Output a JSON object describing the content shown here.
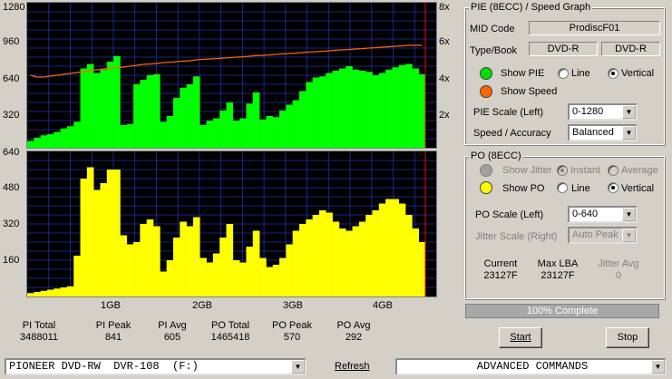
{
  "pie_graph": {
    "left_ticks": [
      "1280",
      "960",
      "640",
      "320"
    ],
    "right_ticks": [
      "8x",
      "6x",
      "4x",
      "2x"
    ]
  },
  "po_graph": {
    "left_ticks": [
      "640",
      "480",
      "320",
      "160"
    ]
  },
  "x_ticks": [
    "1GB",
    "2GB",
    "3GB",
    "4GB"
  ],
  "chart_data": [
    {
      "type": "area",
      "name": "PIE (8ECC)",
      "ylim": [
        0,
        1280
      ],
      "y2lim": [
        0,
        8
      ],
      "yticks": [
        320,
        640,
        960,
        1280
      ],
      "y2ticks": [
        "2x",
        "4x",
        "6x",
        "8x"
      ],
      "xticks": [
        "1GB",
        "2GB",
        "3GB",
        "4GB"
      ],
      "series": [
        {
          "color": "#00ff00",
          "values": [
            60,
            90,
            110,
            120,
            140,
            170,
            190,
            230,
            700,
            740,
            660,
            690,
            760,
            810,
            200,
            210,
            560,
            600,
            640,
            650,
            230,
            280,
            440,
            530,
            560,
            630,
            200,
            240,
            260,
            330,
            400,
            240,
            260,
            390,
            490,
            250,
            280,
            270,
            330,
            380,
            420,
            500,
            580,
            620,
            630,
            660,
            680,
            700,
            720,
            690,
            680,
            670,
            640,
            660,
            690,
            710,
            730,
            740,
            700,
            650
          ]
        },
        {
          "color": "#ff6600",
          "values": [
            4.0,
            3.9,
            3.9,
            3.95,
            4.0,
            4.05,
            4.1,
            4.15,
            4.2,
            4.25,
            4.3,
            4.35,
            4.4,
            4.42,
            4.45,
            4.5,
            4.55,
            4.6,
            4.62,
            4.65,
            4.7,
            4.72,
            4.75,
            4.78,
            4.8,
            4.85,
            4.88,
            4.9,
            4.92,
            4.95,
            4.97,
            5.0,
            5.02,
            5.05,
            5.08,
            5.1,
            5.12,
            5.15,
            5.18,
            5.2,
            5.22,
            5.25,
            5.28,
            5.3,
            5.32,
            5.35,
            5.38,
            5.4,
            5.42,
            5.45,
            5.47,
            5.5,
            5.52,
            5.55,
            5.57,
            5.6,
            5.62,
            5.65,
            5.65,
            5.65
          ]
        }
      ]
    },
    {
      "type": "area",
      "name": "PO (8ECC)",
      "ylim": [
        0,
        640
      ],
      "yticks": [
        160,
        320,
        480,
        640
      ],
      "xticks": [
        "1GB",
        "2GB",
        "3GB",
        "4GB"
      ],
      "series": [
        {
          "color": "#ffff00",
          "values": [
            15,
            20,
            25,
            30,
            35,
            40,
            45,
            180,
            520,
            570,
            470,
            500,
            560,
            560,
            270,
            230,
            240,
            320,
            340,
            310,
            110,
            160,
            260,
            330,
            310,
            350,
            170,
            150,
            190,
            260,
            320,
            160,
            150,
            220,
            290,
            170,
            130,
            140,
            170,
            230,
            290,
            320,
            340,
            360,
            380,
            370,
            330,
            300,
            290,
            310,
            330,
            360,
            380,
            410,
            430,
            430,
            410,
            360,
            300,
            240
          ]
        }
      ]
    }
  ],
  "stats": [
    {
      "label": "PI Total",
      "value": "3488011"
    },
    {
      "label": "PI Peak",
      "value": "841"
    },
    {
      "label": "PI Avg",
      "value": "605"
    },
    {
      "label": "PO Total",
      "value": "1465418"
    },
    {
      "label": "PO Peak",
      "value": "570"
    },
    {
      "label": "PO Avg",
      "value": "292"
    }
  ],
  "pie_panel": {
    "title": "PIE (8ECC) / Speed Graph",
    "mid_label": "MID Code",
    "mid_value": "ProdiscF01",
    "typebook_label": "Type/Book",
    "type_value": "DVD-R",
    "book_value": "DVD-R",
    "show_pie": "Show PIE",
    "show_speed": "Show Speed",
    "line": "Line",
    "vertical": "Vertical",
    "scale_label": "PIE Scale (Left)",
    "scale_value": "0-1280",
    "accuracy_label": "Speed / Accuracy",
    "accuracy_value": "Balanced",
    "pie_color": "#00e000",
    "speed_color": "#ff6600"
  },
  "po_panel": {
    "title": "PO (8ECC)",
    "show_jitter": "Show Jitter",
    "instant": "Instant",
    "average": "Average",
    "show_po": "Show PO",
    "line": "Line",
    "vertical": "Vertical",
    "scale_label": "PO Scale (Left)",
    "scale_value": "0-640",
    "jitter_scale_label": "Jitter Scale (Right)",
    "jitter_scale_value": "Auto Peak",
    "current_label": "Current",
    "current_value": "23127F",
    "maxlba_label": "Max LBA",
    "maxlba_value": "23127F",
    "jitter_avg_label": "Jitter Avg",
    "jitter_avg_value": "0",
    "po_color": "#ffff00"
  },
  "progress": {
    "text": "100% Complete",
    "fraction": 1.0
  },
  "buttons": {
    "start": "Start",
    "stop": "Stop",
    "refresh": "Refresh"
  },
  "drive_select": {
    "value": "PIONEER DVD-RW  DVR-108  (F:)"
  },
  "commands_select": {
    "value": "ADVANCED COMMANDS"
  }
}
